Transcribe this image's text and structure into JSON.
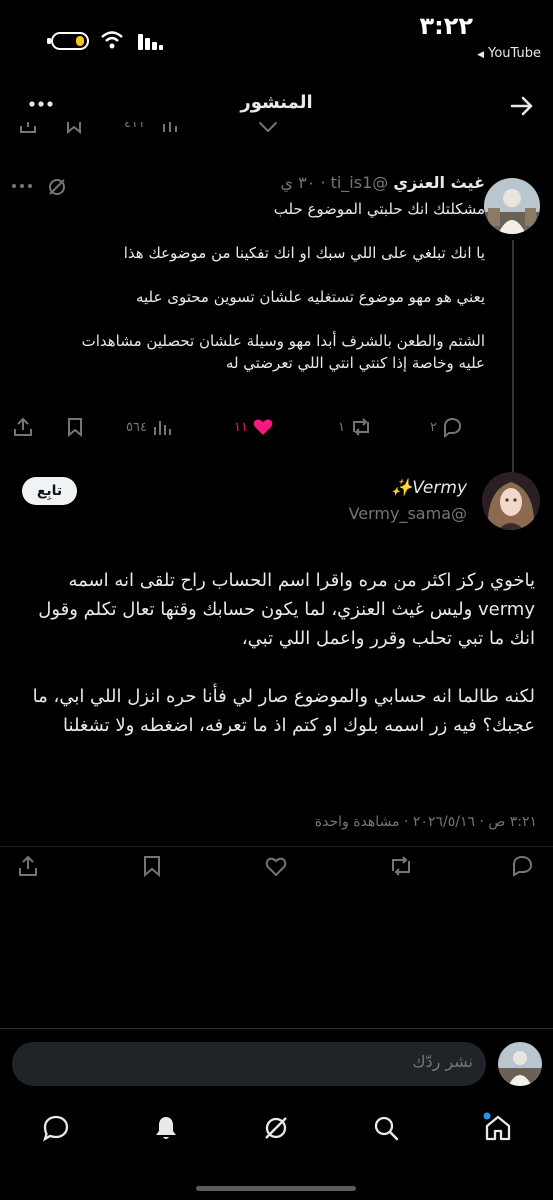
{
  "status_bar": {
    "time": "٣:٢٢",
    "source_app": "YouTube"
  },
  "header": {
    "title": "المنشور"
  },
  "parent_tweet": {
    "clipped_counts": {
      "views": "٤١١",
      "likes": ""
    },
    "author_name": "غيث العنزي",
    "handle": "@ti_is1",
    "time": "٣٠ ي",
    "body": "مشكلتك انك حلبتي الموضوع حلب\n\nيا انك تبلغي على اللي سبك او انك تفكينا من موضوعك هذا\n\nيعني هو مهو موضوع تستغليه علشان تسوين محتوى عليه\n\nالشتم والطعن بالشرف أبدا مهو وسيلة علشان تحصلين مشاهدات عليه وخاصة إذا كنتي انتي اللي تعرضتي له",
    "actions": {
      "replies": "٢",
      "reposts": "١",
      "likes": "١١",
      "views": "٥٦٤"
    }
  },
  "main_tweet": {
    "display_name": "Vermy✨",
    "handle": "@Vermy_sama",
    "follow_label": "تابِع",
    "body": "ياخوي ركز اكثر من مره واقرا اسم الحساب راح تلقى انه اسمه vermy وليس غيث العنزي، لما يكون حسابك وقتها تعال تكلم وقول انك ما تبي تحلب وقرر واعمل اللي تبي،\n\nلكنه طالما انه حسابي والموضوع صار لي فأنا حره انزل اللي ابي، ما عجبك؟ فيه زر اسمه بلوك او كتم اذ ما تعرفه، اضغطه ولا تشغلنا",
    "meta": "٣:٢١ ص · ٢٠٢٦/٥/١٦ · مشاهدة واحدة"
  },
  "reply_box": {
    "placeholder": "نشر ردّك"
  },
  "colors": {
    "like_pink": "#f91880",
    "muted": "#71767b",
    "notification_dot": "#1d9bf0"
  }
}
